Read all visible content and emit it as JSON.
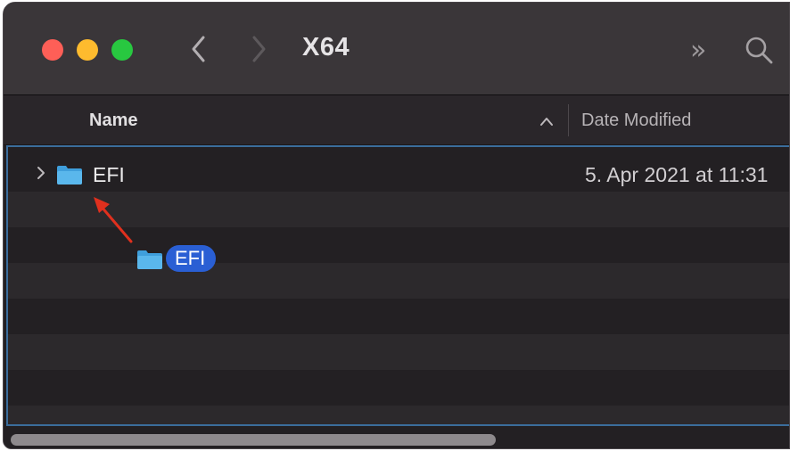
{
  "window": {
    "title": "X64"
  },
  "toolbar": {
    "more_glyph": "»",
    "back_icon": "chevron-left-icon",
    "forward_icon": "chevron-right-icon",
    "search_icon": "search-icon"
  },
  "columns": {
    "name": "Name",
    "date_modified": "Date Modified",
    "sort": "ascending"
  },
  "rows": [
    {
      "name": "EFI",
      "date_modified": "5. Apr 2021 at 11:31",
      "expanded": false
    }
  ],
  "drag_item": {
    "name": "EFI"
  },
  "colors": {
    "close": "#fe5f57",
    "minimize": "#febb2e",
    "zoom": "#28c840",
    "selection_accent": "#2a5fd4",
    "annotation_arrow": "#e0301e",
    "folder": "#5ab7ec"
  }
}
